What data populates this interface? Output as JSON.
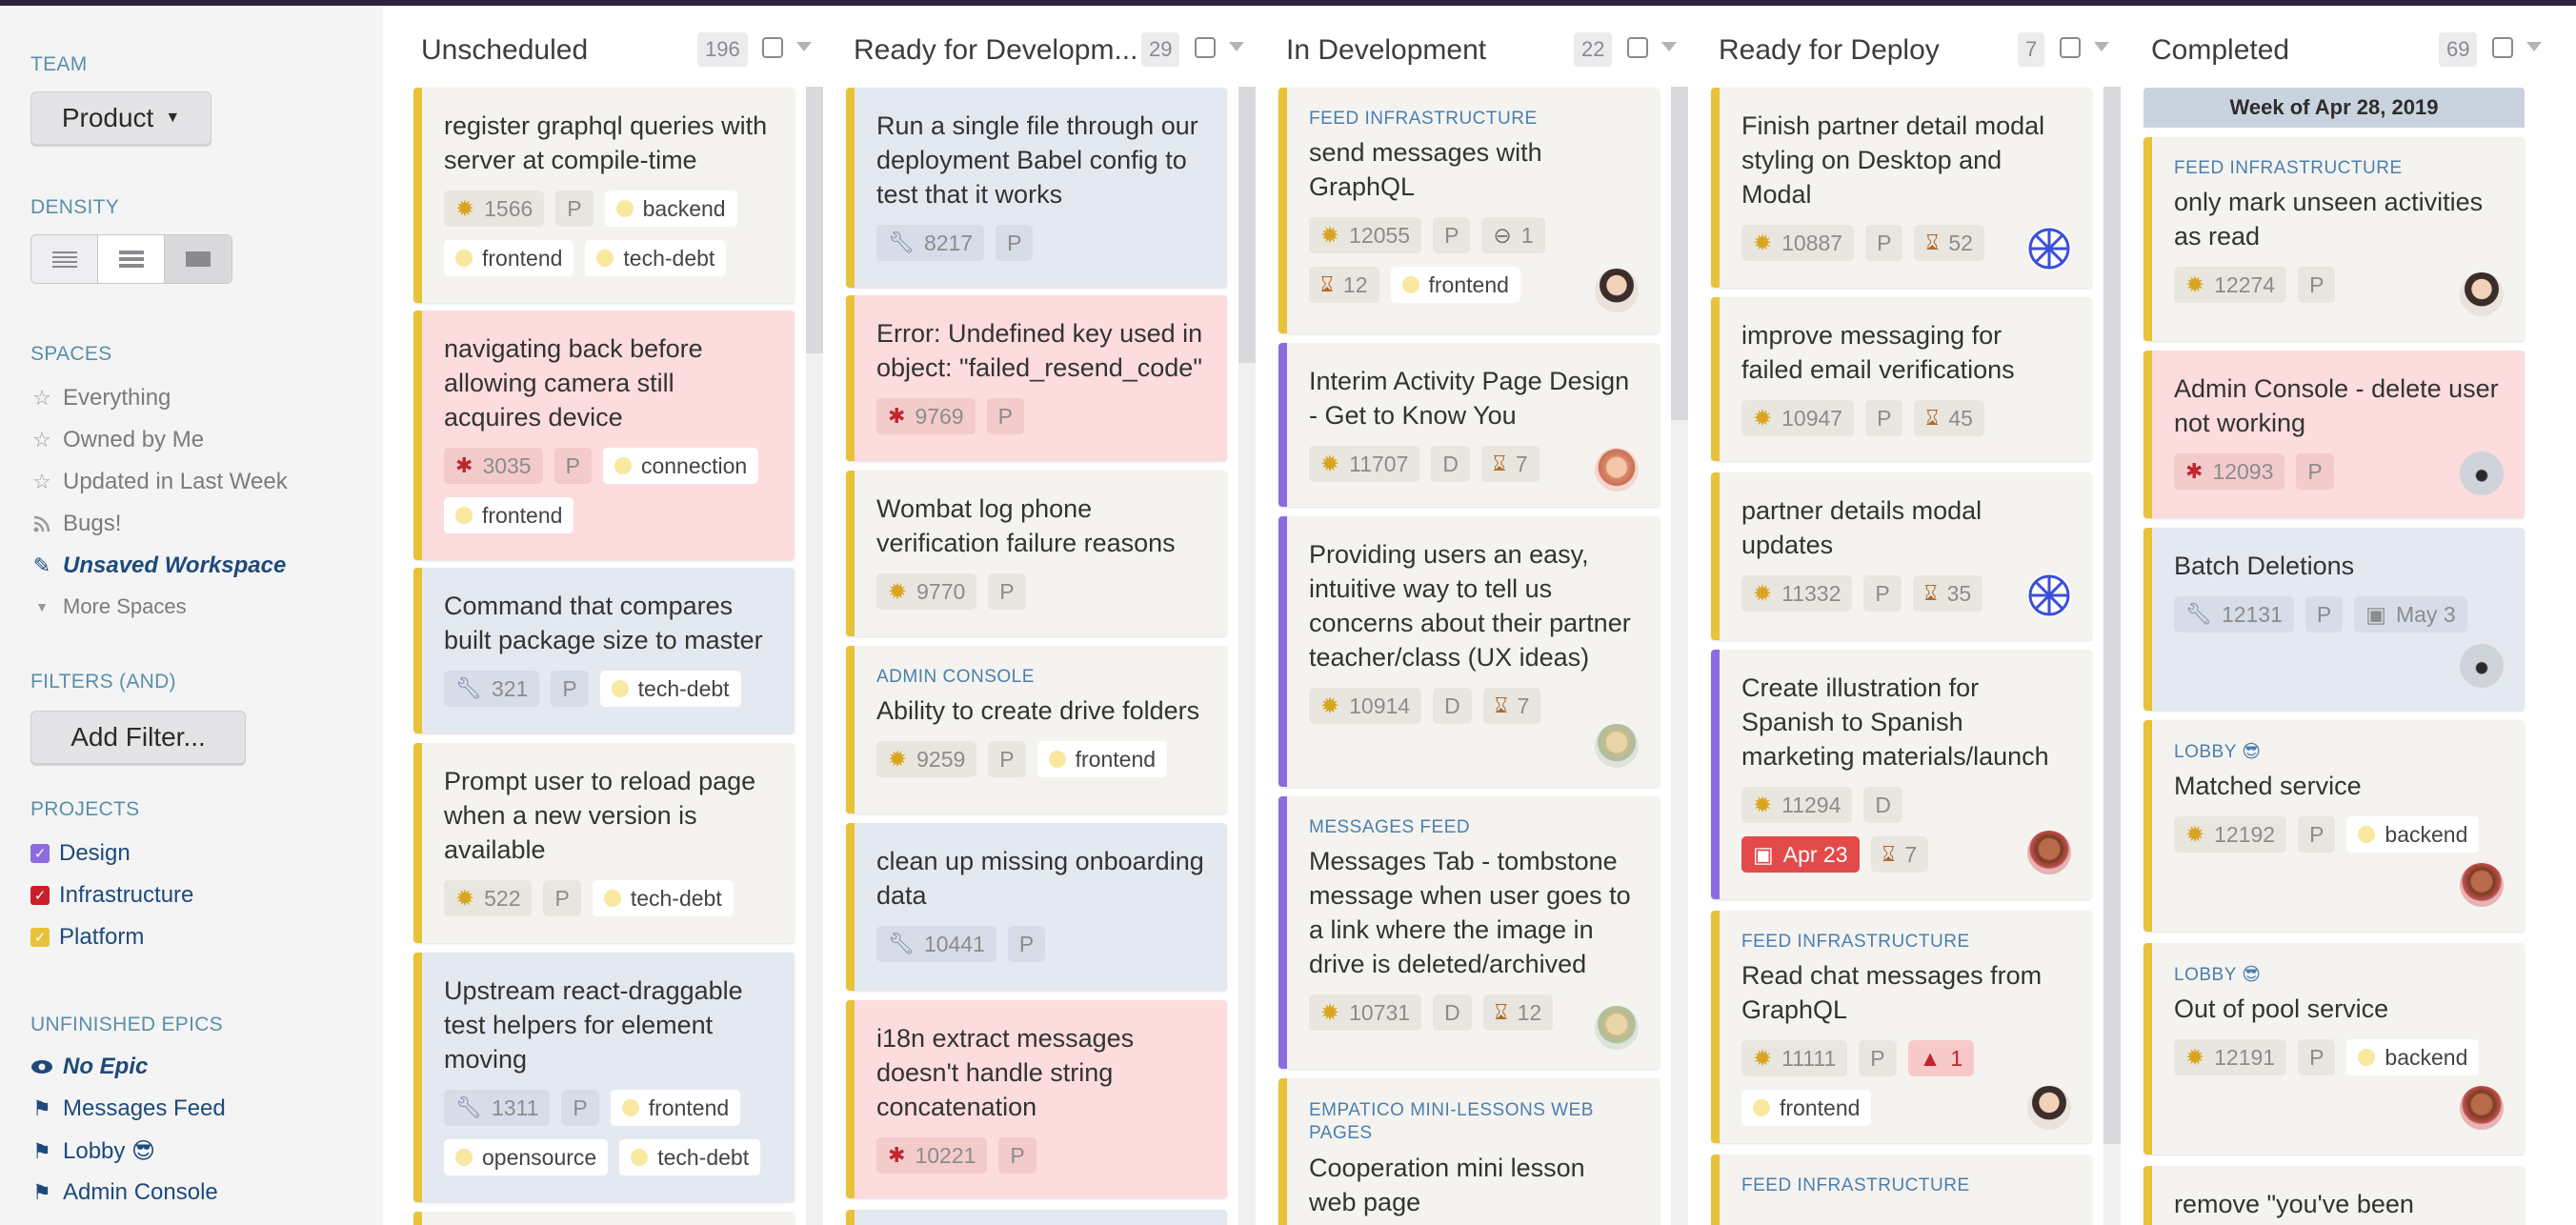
{
  "sidebar": {
    "team_label": "TEAM",
    "team_value": "Product",
    "density_label": "DENSITY",
    "spaces_label": "SPACES",
    "spaces": [
      {
        "label": "Everything",
        "icon": "star-icon"
      },
      {
        "label": "Owned by Me",
        "icon": "star-icon"
      },
      {
        "label": "Updated in Last Week",
        "icon": "star-icon"
      },
      {
        "label": "Bugs!",
        "icon": "rss-icon"
      },
      {
        "label": "Unsaved Workspace",
        "icon": "edit-icon"
      },
      {
        "label": "More Spaces",
        "icon": "caret-down-icon"
      }
    ],
    "filters_label": "FILTERS (AND)",
    "add_filter": "Add Filter...",
    "projects_label": "PROJECTS",
    "projects": [
      {
        "label": "Design",
        "color": "#8b6ce0"
      },
      {
        "label": "Infrastructure",
        "color": "#c8202a"
      },
      {
        "label": "Platform",
        "color": "#e8c23a"
      }
    ],
    "epics_label": "UNFINISHED EPICS",
    "epics": [
      {
        "label": "No Epic",
        "icon": "eye-icon"
      },
      {
        "label": "Messages Feed",
        "icon": "flag-icon"
      },
      {
        "label": "Lobby 😎",
        "icon": "flag-icon"
      },
      {
        "label": "Admin Console",
        "icon": "flag-icon"
      }
    ]
  },
  "columns": [
    {
      "title": "Unscheduled",
      "count": "196"
    },
    {
      "title": "Ready for Developm...",
      "count": "29"
    },
    {
      "title": "In Development",
      "count": "22"
    },
    {
      "title": "Ready for Deploy",
      "count": "7"
    },
    {
      "title": "Completed",
      "count": "69"
    }
  ],
  "completed_week": "Week of Apr 28, 2019",
  "cards": {
    "unscheduled": [
      {
        "title": "register graphql queries with server at compile-time",
        "tags": [
          "1566",
          "P",
          "backend",
          "frontend",
          "tech-debt"
        ]
      },
      {
        "title": "navigating back before allowing camera still acquires device",
        "tags": [
          "3035",
          "P",
          "connection",
          "frontend"
        ]
      },
      {
        "title": "Command that compares built package size to master",
        "tags": [
          "321",
          "P",
          "tech-debt"
        ]
      },
      {
        "title": "Prompt user to reload page when a new version is available",
        "tags": [
          "522",
          "P",
          "tech-debt"
        ]
      },
      {
        "title": "Upstream react-draggable test helpers for element moving",
        "tags": [
          "1311",
          "P",
          "frontend",
          "opensource",
          "tech-debt"
        ]
      }
    ],
    "ready_dev": [
      {
        "title": "Run a single file through our deployment Babel config to test that it works",
        "tags": [
          "8217",
          "P"
        ]
      },
      {
        "title": "Error: Undefined key used in object: \"failed_resend_code\"",
        "tags": [
          "9769",
          "P"
        ]
      },
      {
        "title": "Wombat log phone verification failure reasons",
        "tags": [
          "9770",
          "P"
        ]
      },
      {
        "epic": "ADMIN CONSOLE",
        "title": "Ability to create drive folders",
        "tags": [
          "9259",
          "P",
          "frontend"
        ]
      },
      {
        "title": "clean up missing onboarding data",
        "tags": [
          "10441",
          "P"
        ]
      },
      {
        "title": "i18n extract messages doesn't handle string concatenation",
        "tags": [
          "10221",
          "P"
        ]
      }
    ],
    "in_dev": [
      {
        "epic": "FEED INFRASTRUCTURE",
        "title": "send messages with GraphQL",
        "tags": [
          "12055",
          "P",
          "1",
          "12",
          "frontend"
        ]
      },
      {
        "title": "Interim Activity Page Design - Get to Know You",
        "tags": [
          "11707",
          "D",
          "7"
        ]
      },
      {
        "title": "Providing users an easy, intuitive way to tell us concerns about their partner teacher/class (UX ideas)",
        "tags": [
          "10914",
          "D",
          "7"
        ]
      },
      {
        "epic": "MESSAGES FEED",
        "title": "Messages Tab - tombstone message when user goes to a link where the image in drive is deleted/archived",
        "tags": [
          "10731",
          "D",
          "12"
        ]
      },
      {
        "epic": "EMPATICO MINI-LESSONS WEB PAGES",
        "title": "Cooperation mini lesson web page"
      }
    ],
    "ready_deploy": [
      {
        "title": "Finish partner detail modal styling on Desktop and Modal",
        "tags": [
          "10887",
          "P",
          "52"
        ]
      },
      {
        "title": "improve messaging for failed email verifications",
        "tags": [
          "10947",
          "P",
          "45"
        ]
      },
      {
        "title": "partner details modal updates",
        "tags": [
          "11332",
          "P",
          "35"
        ]
      },
      {
        "title": "Create illustration for Spanish to Spanish marketing materials/launch",
        "tags": [
          "11294",
          "D",
          "Apr 23",
          "7"
        ]
      },
      {
        "epic": "FEED INFRASTRUCTURE",
        "title": "Read chat messages from GraphQL",
        "tags": [
          "11111",
          "P",
          "1",
          "frontend"
        ]
      },
      {
        "epic": "FEED INFRASTRUCTURE"
      }
    ],
    "completed": [
      {
        "epic": "FEED INFRASTRUCTURE",
        "title": "only mark unseen activities as read",
        "tags": [
          "12274",
          "P"
        ]
      },
      {
        "title": "Admin Console - delete user not working",
        "tags": [
          "12093",
          "P"
        ]
      },
      {
        "title": "Batch Deletions",
        "tags": [
          "12131",
          "P",
          "May 3"
        ]
      },
      {
        "epic": "LOBBY 😎",
        "title": "Matched service",
        "tags": [
          "12192",
          "P",
          "backend"
        ]
      },
      {
        "epic": "LOBBY 😎",
        "title": "Out of pool service",
        "tags": [
          "12191",
          "P",
          "backend"
        ]
      },
      {
        "title": "remove \"you've been"
      }
    ]
  },
  "colors": {
    "design": "#8b6ce0",
    "infrastructure": "#c8202a",
    "platform": "#e8c23a",
    "accent": "#1d4a7a"
  }
}
